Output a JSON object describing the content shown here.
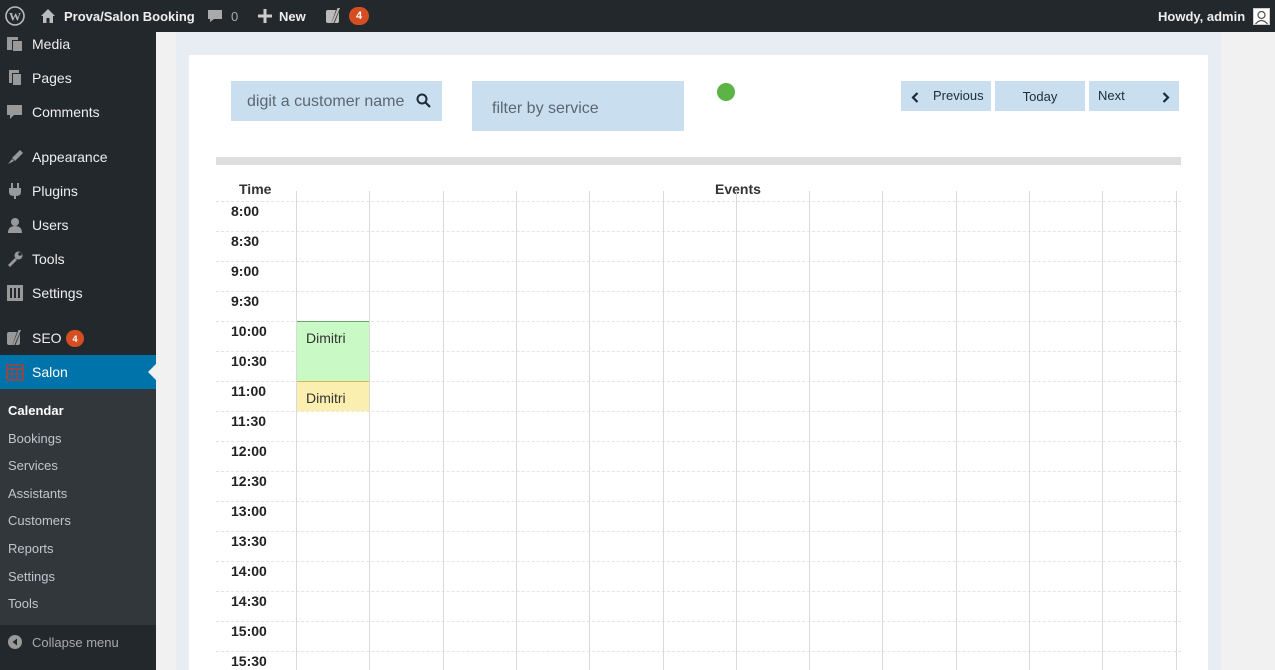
{
  "adminbar": {
    "site_name": "Prova/Salon Booking",
    "comments_count": "0",
    "new_label": "New",
    "seo_count": "4",
    "greeting": "Howdy, admin"
  },
  "sidebar": {
    "items": [
      {
        "label": "Media",
        "icon": "media-icon"
      },
      {
        "label": "Pages",
        "icon": "pages-icon"
      },
      {
        "label": "Comments",
        "icon": "comments-icon"
      },
      {
        "label": "Appearance",
        "icon": "appearance-icon"
      },
      {
        "label": "Plugins",
        "icon": "plugins-icon"
      },
      {
        "label": "Users",
        "icon": "users-icon"
      },
      {
        "label": "Tools",
        "icon": "tools-icon"
      },
      {
        "label": "Settings",
        "icon": "settings-icon"
      },
      {
        "label": "SEO",
        "icon": "seo-icon",
        "badge": "4"
      },
      {
        "label": "Salon",
        "icon": "salon-icon"
      }
    ],
    "submenu": [
      "Calendar",
      "Bookings",
      "Services",
      "Assistants",
      "Customers",
      "Reports",
      "Settings",
      "Tools"
    ],
    "collapse_label": "Collapse menu"
  },
  "toolbar": {
    "customer_search_placeholder": "digit a customer name",
    "service_filter": "filter by service",
    "status_color": "#5bb445",
    "previous_label": "Previous",
    "today_label": "Today",
    "next_label": "Next"
  },
  "calendar": {
    "time_header": "Time",
    "events_header": "Events",
    "times": [
      "8:00",
      "8:30",
      "9:00",
      "9:30",
      "10:00",
      "10:30",
      "11:00",
      "11:30",
      "12:00",
      "12:30",
      "13:00",
      "13:30",
      "14:00",
      "14:30",
      "15:00",
      "15:30"
    ],
    "events": [
      {
        "name": "Dimitri",
        "start": "10:00",
        "end": "11:00",
        "column": 1,
        "color": "#c9f9c4"
      },
      {
        "name": "Dimitri",
        "start": "11:00",
        "end": "11:30",
        "column": 1,
        "color": "#fbefb0"
      }
    ]
  },
  "colors": {
    "admin_dark": "#23282d",
    "accent": "#0073aa",
    "badge": "#d54e21",
    "toolbar_blue": "#c9dff0"
  }
}
